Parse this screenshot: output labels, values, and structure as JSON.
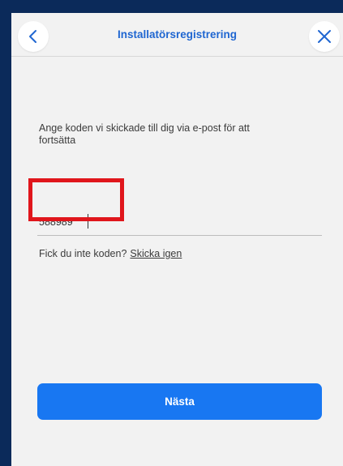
{
  "header": {
    "title": "Installatörsregistrering",
    "back_icon": "chevron-left-icon",
    "close_icon": "close-icon",
    "accent_color": "#1f66d1"
  },
  "form": {
    "instruction": "Ange koden vi skickade till dig via e-post för att fortsätta",
    "code_value": "588989",
    "resend_prompt": "Fick du inte koden?",
    "resend_link": "Skicka igen"
  },
  "actions": {
    "next_label": "Nästa",
    "next_color": "#1877f2"
  },
  "annotation": {
    "highlight_color": "#e0161c"
  }
}
